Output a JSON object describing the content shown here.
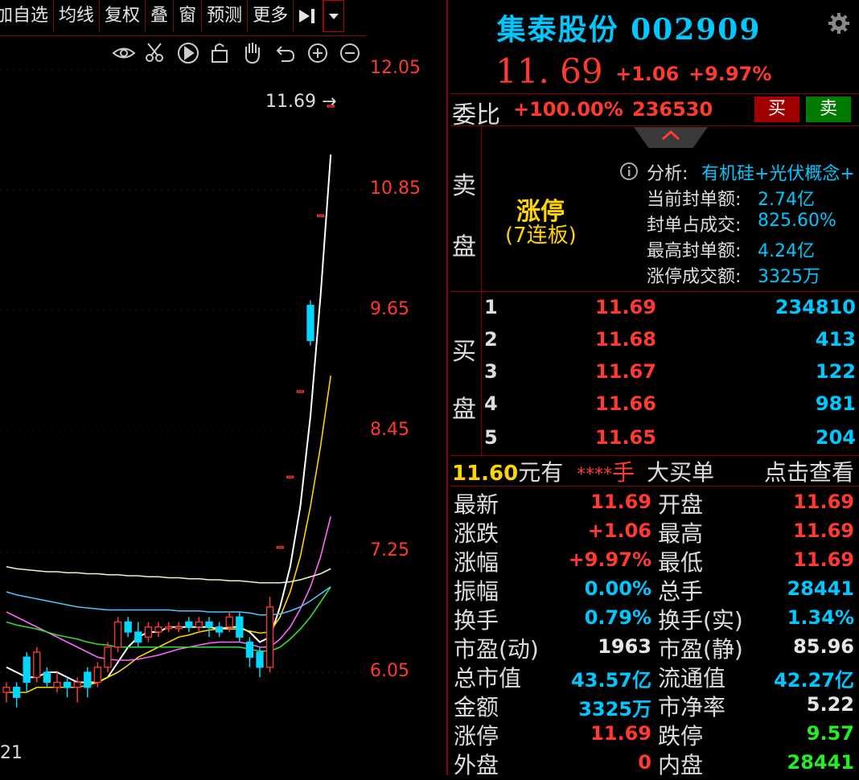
{
  "toolbar": {
    "items": [
      "加自选",
      "均线",
      "复权",
      "叠",
      "窗",
      "预测",
      "更多"
    ],
    "zoom_icons": [
      "eye-icon",
      "scissors-icon",
      "play-icon",
      "lock-icon",
      "hand-icon",
      "undo-icon",
      "zoom-in-icon",
      "zoom-out-icon"
    ]
  },
  "chart": {
    "y_ticks": [
      "12.05",
      "10.85",
      "9.65",
      "8.45",
      "7.25",
      "6.05"
    ],
    "last_price_label": "11.69",
    "x_fragment": "21"
  },
  "chart_data": {
    "type": "line",
    "y_ticks": [
      12.05,
      10.85,
      9.65,
      8.45,
      7.25,
      6.05
    ],
    "ylim": [
      5.5,
      12.6
    ],
    "last_price": 11.69,
    "candles": [
      [
        5.85,
        5.9,
        5.75,
        5.95
      ],
      [
        5.9,
        5.8,
        5.7,
        5.95
      ],
      [
        6.2,
        5.95,
        5.85,
        6.25
      ],
      [
        6.0,
        6.25,
        5.95,
        6.3
      ],
      [
        6.05,
        5.95,
        5.9,
        6.1
      ],
      [
        5.9,
        5.95,
        5.85,
        6.05
      ],
      [
        5.95,
        5.9,
        5.8,
        6.0
      ],
      [
        5.9,
        5.95,
        5.75,
        6.0
      ],
      [
        6.05,
        5.9,
        5.8,
        6.1
      ],
      [
        5.95,
        6.1,
        5.9,
        6.15
      ],
      [
        6.1,
        6.3,
        6.05,
        6.35
      ],
      [
        6.3,
        6.55,
        6.25,
        6.6
      ],
      [
        6.55,
        6.45,
        6.4,
        6.6
      ],
      [
        6.45,
        6.35,
        6.3,
        6.55
      ],
      [
        6.4,
        6.5,
        6.35,
        6.55
      ],
      [
        6.45,
        6.5,
        6.4,
        6.55
      ],
      [
        6.5,
        6.5,
        6.45,
        6.55
      ],
      [
        6.5,
        6.5,
        6.45,
        6.55
      ],
      [
        6.55,
        6.5,
        6.45,
        6.6
      ],
      [
        6.5,
        6.55,
        6.45,
        6.6
      ],
      [
        6.55,
        6.5,
        6.4,
        6.6
      ],
      [
        6.5,
        6.45,
        6.4,
        6.55
      ],
      [
        6.5,
        6.6,
        6.45,
        6.65
      ],
      [
        6.6,
        6.4,
        6.35,
        6.65
      ],
      [
        6.35,
        6.2,
        6.1,
        6.4
      ],
      [
        6.25,
        6.1,
        6.0,
        6.3
      ],
      [
        6.1,
        6.7,
        6.05,
        6.8
      ],
      [
        7.3,
        7.3,
        7.3,
        7.3
      ],
      [
        8.0,
        8.0,
        8.0,
        8.0
      ],
      [
        8.85,
        8.85,
        8.85,
        8.85
      ],
      [
        9.7,
        9.35,
        9.3,
        9.75
      ],
      [
        10.6,
        10.6,
        10.6,
        10.6
      ],
      [
        11.69,
        11.69,
        11.69,
        11.69
      ]
    ],
    "candle_fields": [
      "open",
      "close",
      "low",
      "high"
    ],
    "series": [
      {
        "values": [
          6.1,
          6.05,
          6.0,
          6.0,
          6.05,
          6.05,
          6.0,
          5.95,
          5.95,
          5.95,
          6.0,
          6.15,
          6.3,
          6.4,
          6.45,
          6.45,
          6.5,
          6.5,
          6.5,
          6.5,
          6.5,
          6.48,
          6.5,
          6.5,
          6.45,
          6.35,
          6.4,
          6.7,
          7.1,
          7.7,
          8.6,
          9.8,
          11.2
        ],
        "color": "#ffffff"
      },
      {
        "values": [
          5.85,
          5.85,
          5.85,
          5.9,
          5.9,
          5.9,
          5.9,
          5.9,
          5.92,
          5.95,
          6.0,
          6.05,
          6.12,
          6.2,
          6.25,
          6.3,
          6.35,
          6.4,
          6.42,
          6.45,
          6.47,
          6.48,
          6.48,
          6.48,
          6.46,
          6.44,
          6.45,
          6.6,
          6.85,
          7.2,
          7.7,
          8.3,
          9.0
        ],
        "color": "#ffd400"
      },
      {
        "values": [
          6.65,
          6.6,
          6.55,
          6.5,
          6.45,
          6.4,
          6.35,
          6.3,
          6.25,
          6.2,
          6.18,
          6.17,
          6.17,
          6.18,
          6.2,
          6.22,
          6.25,
          6.28,
          6.3,
          6.32,
          6.34,
          6.35,
          6.35,
          6.35,
          6.33,
          6.3,
          6.3,
          6.38,
          6.5,
          6.68,
          6.9,
          7.2,
          7.6
        ],
        "color": "#ff66ff"
      },
      {
        "values": [
          6.55,
          6.52,
          6.5,
          6.48,
          6.45,
          6.42,
          6.4,
          6.38,
          6.35,
          6.33,
          6.32,
          6.3,
          6.3,
          6.3,
          6.3,
          6.3,
          6.3,
          6.3,
          6.3,
          6.3,
          6.3,
          6.3,
          6.3,
          6.3,
          6.28,
          6.26,
          6.26,
          6.3,
          6.38,
          6.48,
          6.6,
          6.75,
          6.9
        ],
        "color": "#33dd33"
      },
      {
        "values": [
          6.85,
          6.82,
          6.8,
          6.78,
          6.76,
          6.74,
          6.72,
          6.7,
          6.69,
          6.68,
          6.67,
          6.67,
          6.67,
          6.67,
          6.67,
          6.67,
          6.67,
          6.66,
          6.66,
          6.66,
          6.65,
          6.65,
          6.65,
          6.65,
          6.64,
          6.62,
          6.62,
          6.63,
          6.66,
          6.7,
          6.76,
          6.83,
          6.9
        ],
        "color": "#4fc3ff"
      },
      {
        "values": [
          7.1,
          7.08,
          7.07,
          7.06,
          7.05,
          7.05,
          7.04,
          7.04,
          7.03,
          7.03,
          7.02,
          7.02,
          7.01,
          7.01,
          7.0,
          7.0,
          6.99,
          6.99,
          6.98,
          6.98,
          6.97,
          6.97,
          6.96,
          6.96,
          6.95,
          6.94,
          6.94,
          6.94,
          6.95,
          6.97,
          7.0,
          7.03,
          7.08
        ],
        "color": "#f5f0c8"
      }
    ]
  },
  "stock": {
    "title": "集泰股份 002909",
    "price": "11. 69",
    "change": "+1.06",
    "change_pct": "+9.97%"
  },
  "weibi": {
    "label": "委比",
    "pct": "+100.00%",
    "num": "236530",
    "buy": "买",
    "sell": "卖"
  },
  "sell_side": {
    "label_top": "卖",
    "label_bottom": "盘",
    "status": "涨停",
    "status_sub": "(7连板)"
  },
  "analysis": [
    {
      "label": "分析:",
      "value": "有机硅+光伏概念+"
    },
    {
      "label": "当前封单额:",
      "value": "2.74亿"
    },
    {
      "label": "封单占成交:",
      "value": "825.60%"
    },
    {
      "label": "最高封单额:",
      "value": "4.24亿"
    },
    {
      "label": "涨停成交额:",
      "value": "3325万"
    }
  ],
  "buy_side": {
    "label_top": "买",
    "label_bottom": "盘",
    "levels": [
      {
        "lvl": "1",
        "price": "11.69",
        "vol": "234810"
      },
      {
        "lvl": "2",
        "price": "11.68",
        "vol": "413"
      },
      {
        "lvl": "3",
        "price": "11.67",
        "vol": "122"
      },
      {
        "lvl": "4",
        "price": "11.66",
        "vol": "981"
      },
      {
        "lvl": "5",
        "price": "11.65",
        "vol": "204"
      }
    ]
  },
  "big_order": {
    "price": "11.60",
    "unit": "元有",
    "stars": "****",
    "hand": "手",
    "label": "大买单",
    "link": "点击查看"
  },
  "stats": [
    {
      "l1": "最新",
      "v1": "11.69",
      "c1": "red",
      "l2": "开盘",
      "v2": "11.69",
      "c2": "red"
    },
    {
      "l1": "涨跌",
      "v1": "+1.06",
      "c1": "red",
      "l2": "最高",
      "v2": "11.69",
      "c2": "red"
    },
    {
      "l1": "涨幅",
      "v1": "+9.97%",
      "c1": "red",
      "l2": "最低",
      "v2": "11.69",
      "c2": "red"
    },
    {
      "l1": "振幅",
      "v1": "0.00%",
      "c1": "cyan",
      "l2": "总手",
      "v2": "28441",
      "c2": "cyan"
    },
    {
      "l1": "换手",
      "v1": "0.79%",
      "c1": "cyan",
      "l2": "换手(实)",
      "v2": "1.34%",
      "c2": "cyan"
    },
    {
      "l1": "市盈(动)",
      "v1": "1963",
      "c1": "white",
      "l2": "市盈(静)",
      "v2": "85.96",
      "c2": "white"
    },
    {
      "l1": "总市值",
      "v1": "43.57亿",
      "c1": "cyan",
      "l2": "流通值",
      "v2": "42.27亿",
      "c2": "cyan"
    },
    {
      "l1": "金额",
      "v1": "3325万",
      "c1": "cyan",
      "l2": "市净率",
      "v2": "5.22",
      "c2": "white"
    },
    {
      "l1": "涨停",
      "v1": "11.69",
      "c1": "red",
      "l2": "跌停",
      "v2": "9.57",
      "c2": "green"
    },
    {
      "l1": "外盘",
      "v1": "0",
      "c1": "red",
      "l2": "内盘",
      "v2": "28441",
      "c2": "green"
    }
  ],
  "colors": {
    "up": "#ff3b30",
    "down": "#00c8ff",
    "accent": "#00c8ff",
    "border": "#8b0000"
  }
}
